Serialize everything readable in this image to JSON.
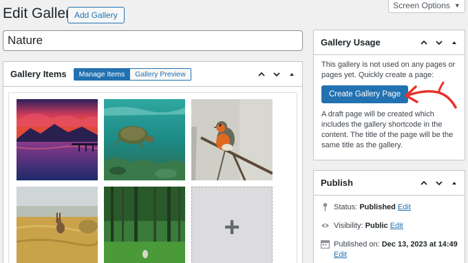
{
  "header": {
    "title": "Edit Gallery",
    "add_label": "Add Gallery",
    "screen_options_label": "Screen Options"
  },
  "gallery_title_value": "Nature",
  "gallery_items": {
    "title": "Gallery Items",
    "tabs": [
      {
        "label": "Manage Items",
        "active": true
      },
      {
        "label": "Gallery Preview",
        "active": false
      }
    ],
    "images": [
      {
        "subject": "sunset-lake-mountains"
      },
      {
        "subject": "sea-turtle-underwater"
      },
      {
        "subject": "robin-on-branch"
      },
      {
        "subject": "hare-in-wheat-field"
      },
      {
        "subject": "green-forest-path"
      }
    ]
  },
  "usage": {
    "title": "Gallery Usage",
    "intro": "This gallery is not used on any pages or pages yet. Quickly create a page:",
    "button_label": "Create Gallery Page",
    "note": "A draft page will be created which includes the gallery shortcode in the content. The title of the page will be the same title as the gallery.",
    "annotation_color": "#e8312a"
  },
  "publish": {
    "title": "Publish",
    "status_label": "Status:",
    "status_value": "Published",
    "visibility_label": "Visibility:",
    "visibility_value": "Public",
    "published_label": "Published on:",
    "published_value": "Dec 13, 2023 at 14:49",
    "edit_label": "Edit"
  },
  "colors": {
    "accent": "#2271b1",
    "background": "#f0f0f1"
  }
}
